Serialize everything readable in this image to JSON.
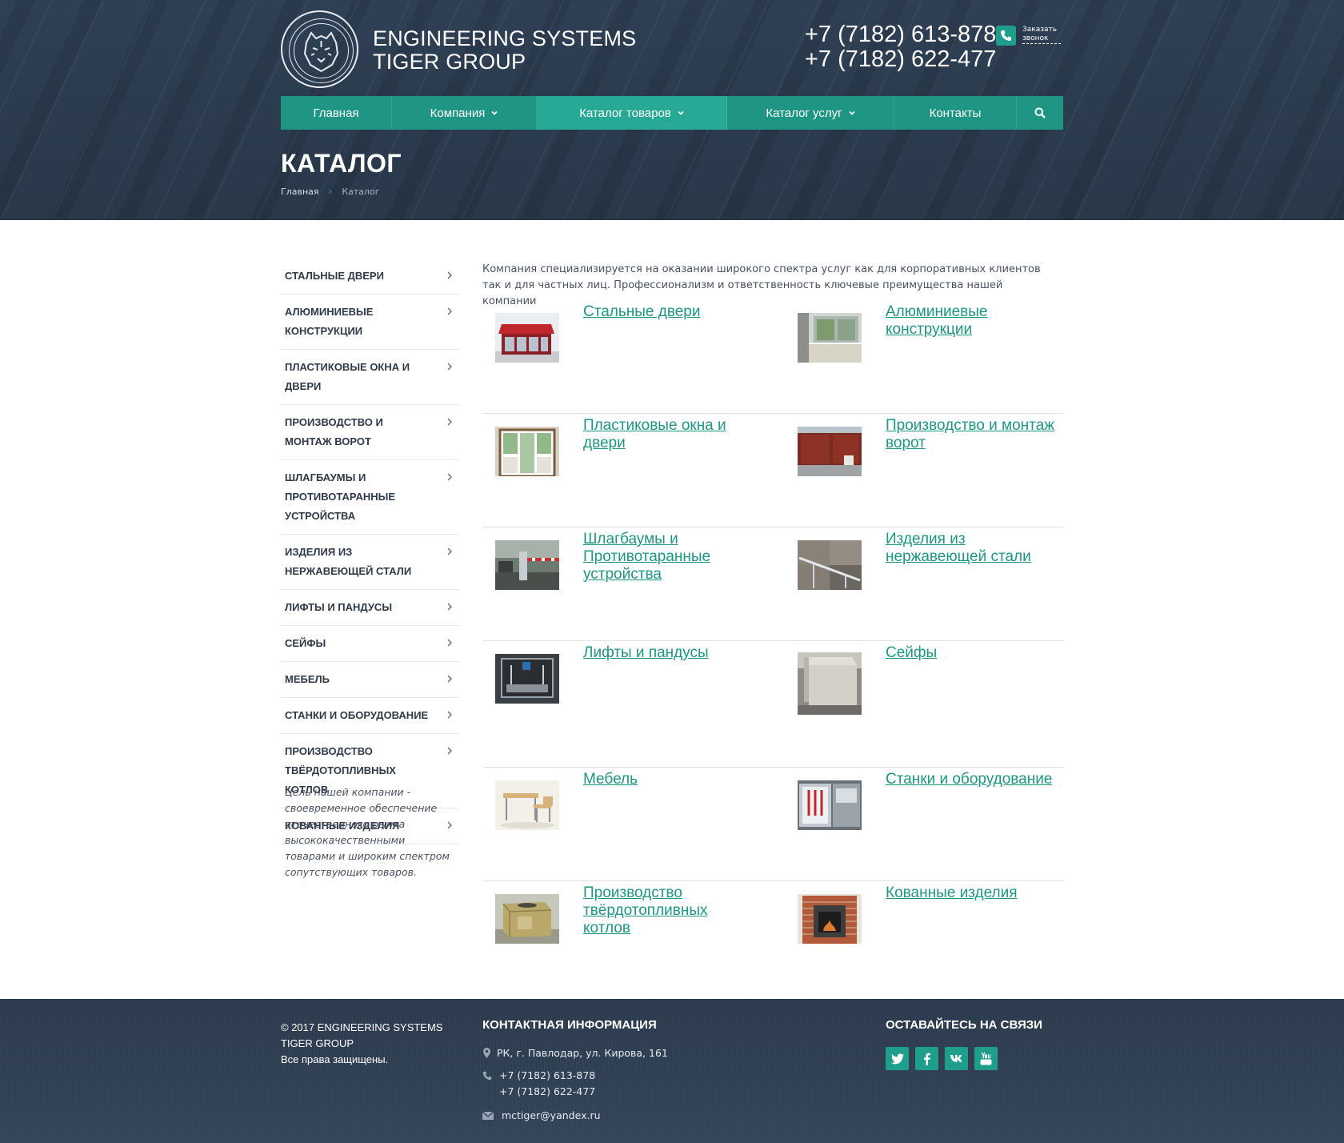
{
  "header": {
    "brand_line1": "ENGINEERING SYSTEMS",
    "brand_line2": "TIGER GROUP",
    "phone1": "+7 (7182) 613-878",
    "phone2": "+7 (7182) 622-477",
    "callback_label": "Заказать звонок"
  },
  "nav": {
    "items": [
      {
        "label": "Главная"
      },
      {
        "label": "Компания"
      },
      {
        "label": "Каталог товаров"
      },
      {
        "label": "Каталог услуг"
      },
      {
        "label": "Контакты"
      }
    ],
    "icons": {
      "dropdown": "chevron-down-icon",
      "search": "search-icon"
    }
  },
  "page": {
    "title": "КАТАЛОГ",
    "breadcrumb": {
      "home": "Главная",
      "separator": "›",
      "current": "Каталог"
    }
  },
  "sidebar": {
    "items": [
      {
        "label": "Стальные двери"
      },
      {
        "label": "Алюминиевые конструкции"
      },
      {
        "label": "Пластиковые окна и двери"
      },
      {
        "label": "Производство и монтаж ворот"
      },
      {
        "label": "Шлагбаумы и противотаранные устройства"
      },
      {
        "label": "Изделия из нержавеющей стали"
      },
      {
        "label": "Лифты и пандусы"
      },
      {
        "label": "Сейфы"
      },
      {
        "label": "Мебель"
      },
      {
        "label": "Станки и оборудование"
      },
      {
        "label": "Производство твёрдотопливных котлов"
      },
      {
        "label": "Кованные изделия"
      }
    ],
    "note": "Цель нашей компании - своевременное обеспечение отечественного рынка высококачественными товарами и широким спектром сопутствующих товаров."
  },
  "content": {
    "intro": "Компания специализируется на оказании широкого спектра услуг как для корпоративных клиентов так и для частных лиц. Профессионализм и ответственность ключевые преимущества нашей компании",
    "categories": [
      {
        "label": "Стальные двери",
        "thumb": "kiosk-photo"
      },
      {
        "label": "Алюминиевые конструкции",
        "thumb": "balcony-photo"
      },
      {
        "label": "Пластиковые окна и двери",
        "thumb": "window-door-photo"
      },
      {
        "label": "Производство и монтаж ворот",
        "thumb": "gate-photo"
      },
      {
        "label": "Шлагбаумы и Противотаранные устройства",
        "thumb": "barrier-photo"
      },
      {
        "label": "Изделия из нержавеющей стали",
        "thumb": "handrail-photo"
      },
      {
        "label": "Лифты и пандусы",
        "thumb": "lift-photo"
      },
      {
        "label": "Сейфы",
        "thumb": "safe-photo"
      },
      {
        "label": "Мебель",
        "thumb": "school-desk-photo"
      },
      {
        "label": "Станки и оборудование",
        "thumb": "machine-photo"
      },
      {
        "label": "Производство твёрдотопливных котлов",
        "thumb": "boiler-photo"
      },
      {
        "label": "Кованные изделия",
        "thumb": "fireplace-photo"
      }
    ]
  },
  "footer": {
    "copy_line1": "© 2017 ENGINEERING SYSTEMS",
    "copy_line2": "TIGER GROUP",
    "copy_line3": "Все права защищены.",
    "contacts_title": "КОНТАКТНАЯ ИНФОРМАЦИЯ",
    "address": "РК, г. Павлодар, ул. Кирова, 161",
    "phone1": "+7 (7182) 613-878",
    "phone2": "+7 (7182) 622-477",
    "email": "mctiger@yandex.ru",
    "social_title": "ОСТАВАЙТЕСЬ НА СВЯЗИ",
    "social": [
      "twitter-icon",
      "facebook-icon",
      "vk-icon",
      "youtube-icon"
    ]
  },
  "colors": {
    "accent": "#1f9684",
    "accent_active": "#27a996",
    "header_bg": "#2b3a4c",
    "link": "#1f9684"
  }
}
